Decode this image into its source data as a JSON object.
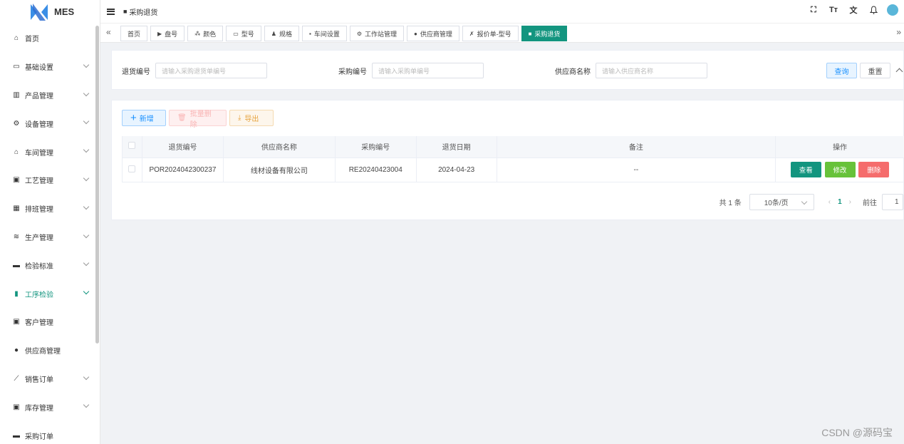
{
  "app": {
    "name": "MES",
    "colors": {
      "primary": "#13957f",
      "success": "#67c23a",
      "danger": "#f56c6c",
      "info": "#1890ff",
      "warning": "#e6a23c"
    }
  },
  "sidebar": {
    "items": [
      {
        "icon": "home-icon",
        "label": "首页",
        "has_children": false
      },
      {
        "icon": "monitor-icon",
        "label": "基础设置",
        "has_children": true
      },
      {
        "icon": "bar-chart-icon",
        "label": "产品管理",
        "has_children": true
      },
      {
        "icon": "gear-icon",
        "label": "设备管理",
        "has_children": true
      },
      {
        "icon": "factory-icon",
        "label": "车间管理",
        "has_children": true
      },
      {
        "icon": "process-icon",
        "label": "工艺管理",
        "has_children": true
      },
      {
        "icon": "calendar-icon",
        "label": "排班管理",
        "has_children": true
      },
      {
        "icon": "database-icon",
        "label": "生产管理",
        "has_children": true
      },
      {
        "icon": "screen-icon",
        "label": "检验标准",
        "has_children": true
      },
      {
        "icon": "book-icon",
        "label": "工序检验",
        "has_children": true,
        "active": true
      },
      {
        "icon": "contact-icon",
        "label": "客户管理",
        "has_children": false
      },
      {
        "icon": "user-icon",
        "label": "供应商管理",
        "has_children": false
      },
      {
        "icon": "chart-line-icon",
        "label": "销售订单",
        "has_children": true
      },
      {
        "icon": "box-icon",
        "label": "库存管理",
        "has_children": true
      },
      {
        "icon": "cart-icon",
        "label": "采购订单",
        "has_children": false
      }
    ]
  },
  "header": {
    "breadcrumb": "采购退货",
    "icons": [
      "fullscreen-icon",
      "font-size-icon",
      "translate-icon",
      "bell-icon"
    ]
  },
  "tags": [
    {
      "label": "首页",
      "icon": "",
      "active": false
    },
    {
      "label": "盘号",
      "icon": "▶",
      "active": false
    },
    {
      "label": "颜色",
      "icon": "⁂",
      "active": false
    },
    {
      "label": "型号",
      "icon": "▭",
      "active": false
    },
    {
      "label": "规格",
      "icon": "♟",
      "active": false
    },
    {
      "label": "车间设置",
      "icon": "▪",
      "active": false
    },
    {
      "label": "工作站管理",
      "icon": "⚙",
      "active": false
    },
    {
      "label": "供应商管理",
      "icon": "●",
      "active": false
    },
    {
      "label": "报价单-型号",
      "icon": "✗",
      "active": false
    },
    {
      "label": "采购退货",
      "icon": "■",
      "active": true
    }
  ],
  "search": {
    "return_no_label": "退货编号",
    "return_no_placeholder": "请输入采购退货单编号",
    "purchase_no_label": "采购编号",
    "purchase_no_placeholder": "请输入采购单编号",
    "supplier_label": "供应商名称",
    "supplier_placeholder": "请输入供应商名称",
    "query_label": "查询",
    "reset_label": "重置"
  },
  "toolbar": {
    "add_label": "新增",
    "batch_delete_label": "批量删除",
    "export_label": "导出"
  },
  "table": {
    "columns": [
      "退货编号",
      "供应商名称",
      "采购编号",
      "退货日期",
      "备注",
      "操作"
    ],
    "rows": [
      {
        "return_no": "POR2024042300237",
        "supplier": "线材设备有限公司",
        "purchase_no": "RE20240423004",
        "date": "2024-04-23",
        "remark": "--"
      }
    ],
    "actions": {
      "view": "查看",
      "edit": "修改",
      "delete": "删除"
    }
  },
  "pagination": {
    "total_text": "共 1 条",
    "page_size": "10条/页",
    "current_page": "1",
    "goto_label": "前往",
    "goto_value": "1"
  },
  "watermark": "CSDN @源码宝"
}
